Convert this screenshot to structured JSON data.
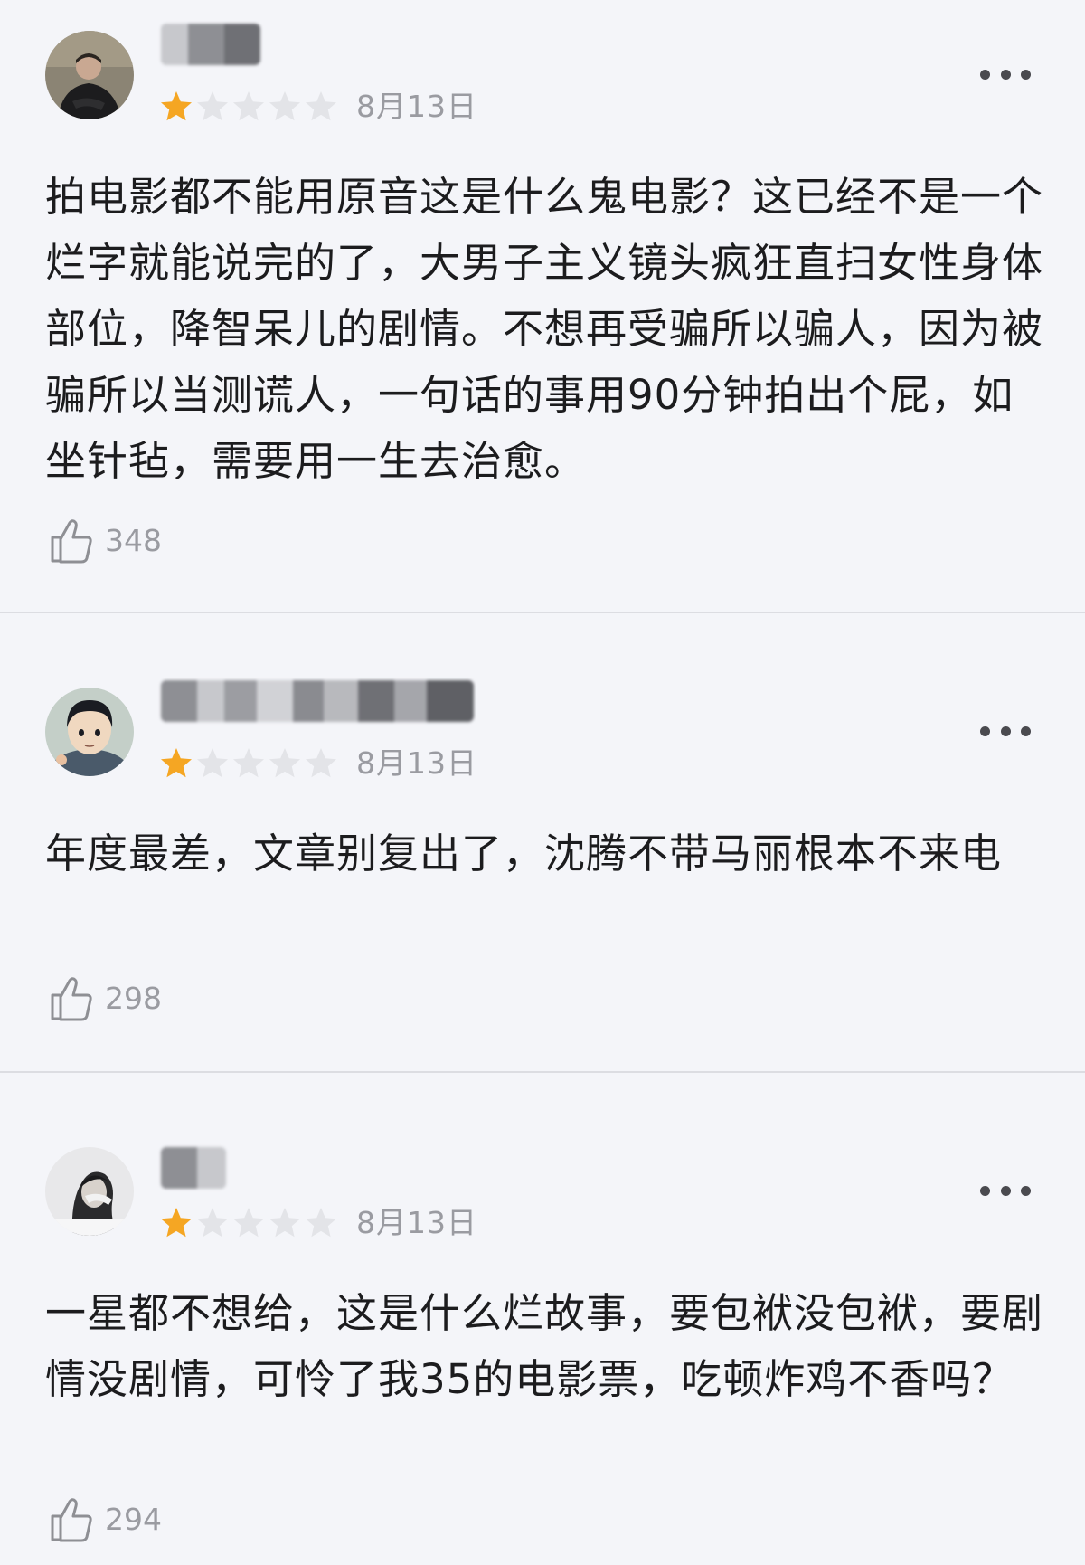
{
  "reviews": [
    {
      "username": "███",
      "rating": 1,
      "max_rating": 5,
      "date": "8月13日",
      "content": "拍电影都不能用原音这是什么鬼电影？这已经不是一个烂字就能说完的了，大男子主义镜头疯狂直扫女性身体部位，降智呆儿的剧情。不想再受骗所以骗人，因为被骗所以当测谎人，一句话的事用90分钟拍出个屁，如坐针毡，需要用一生去治愈。",
      "likes": "348"
    },
    {
      "username": "█████████",
      "rating": 1,
      "max_rating": 5,
      "date": "8月13日",
      "content": "年度最差，文章别复出了，沈腾不带马丽根本不来电",
      "likes": "298"
    },
    {
      "username": "██",
      "rating": 1,
      "max_rating": 5,
      "date": "8月13日",
      "content": "一星都不想给，这是什么烂故事，要包袱没包袱，要剧情没剧情，可怜了我35的电影票，吃顿炸鸡不香吗？",
      "likes": "294"
    }
  ],
  "colors": {
    "background": "#f4f5f9",
    "star_filled": "#f5a623",
    "star_empty": "#e3e4e8",
    "meta_text": "#9a9ba1",
    "divider": "#dcdde2"
  },
  "icons": {
    "like": "thumbs-up-icon",
    "more": "more-dots-icon",
    "star": "star-icon"
  }
}
